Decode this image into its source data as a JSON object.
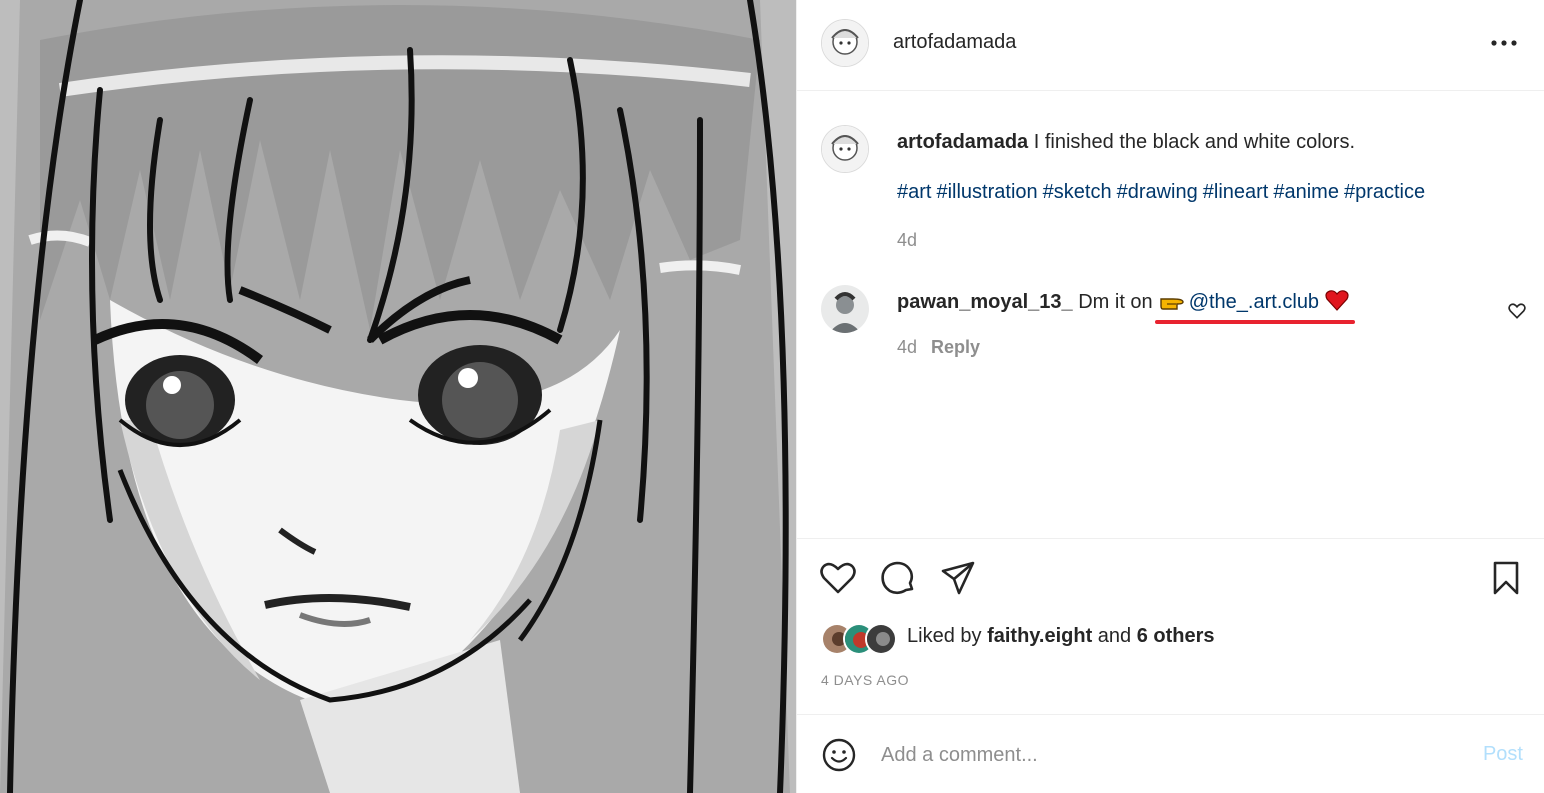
{
  "post": {
    "username": "artofadamada",
    "more_icon": "more-horizontal-icon",
    "image_alt": "black and white anime girl illustration"
  },
  "caption": {
    "username": "artofadamada",
    "text": " I finished the black and white colors.",
    "hashtags": [
      "#art",
      "#illustration",
      "#sketch",
      "#drawing",
      "#lineart",
      "#anime",
      "#practice"
    ],
    "time": "4d"
  },
  "comment": {
    "username": "pawan_moyal_13_",
    "text": " Dm it on",
    "mention": "@the_.art.club",
    "time": "4d",
    "reply_label": "Reply",
    "highlight_color": "#e8232f"
  },
  "actions": {
    "icons": [
      "heart-icon",
      "comment-icon",
      "share-icon",
      "bookmark-icon"
    ]
  },
  "likes": {
    "prefix": "Liked by ",
    "user": "faithy.eight",
    "middle": " and ",
    "others": "6 others"
  },
  "date": "4 DAYS AGO",
  "add_comment": {
    "placeholder": "Add a comment...",
    "post_label": "Post"
  },
  "colors": {
    "link": "#00376b",
    "muted": "#8e8e8e",
    "post_disabled": "#b2dffc"
  }
}
